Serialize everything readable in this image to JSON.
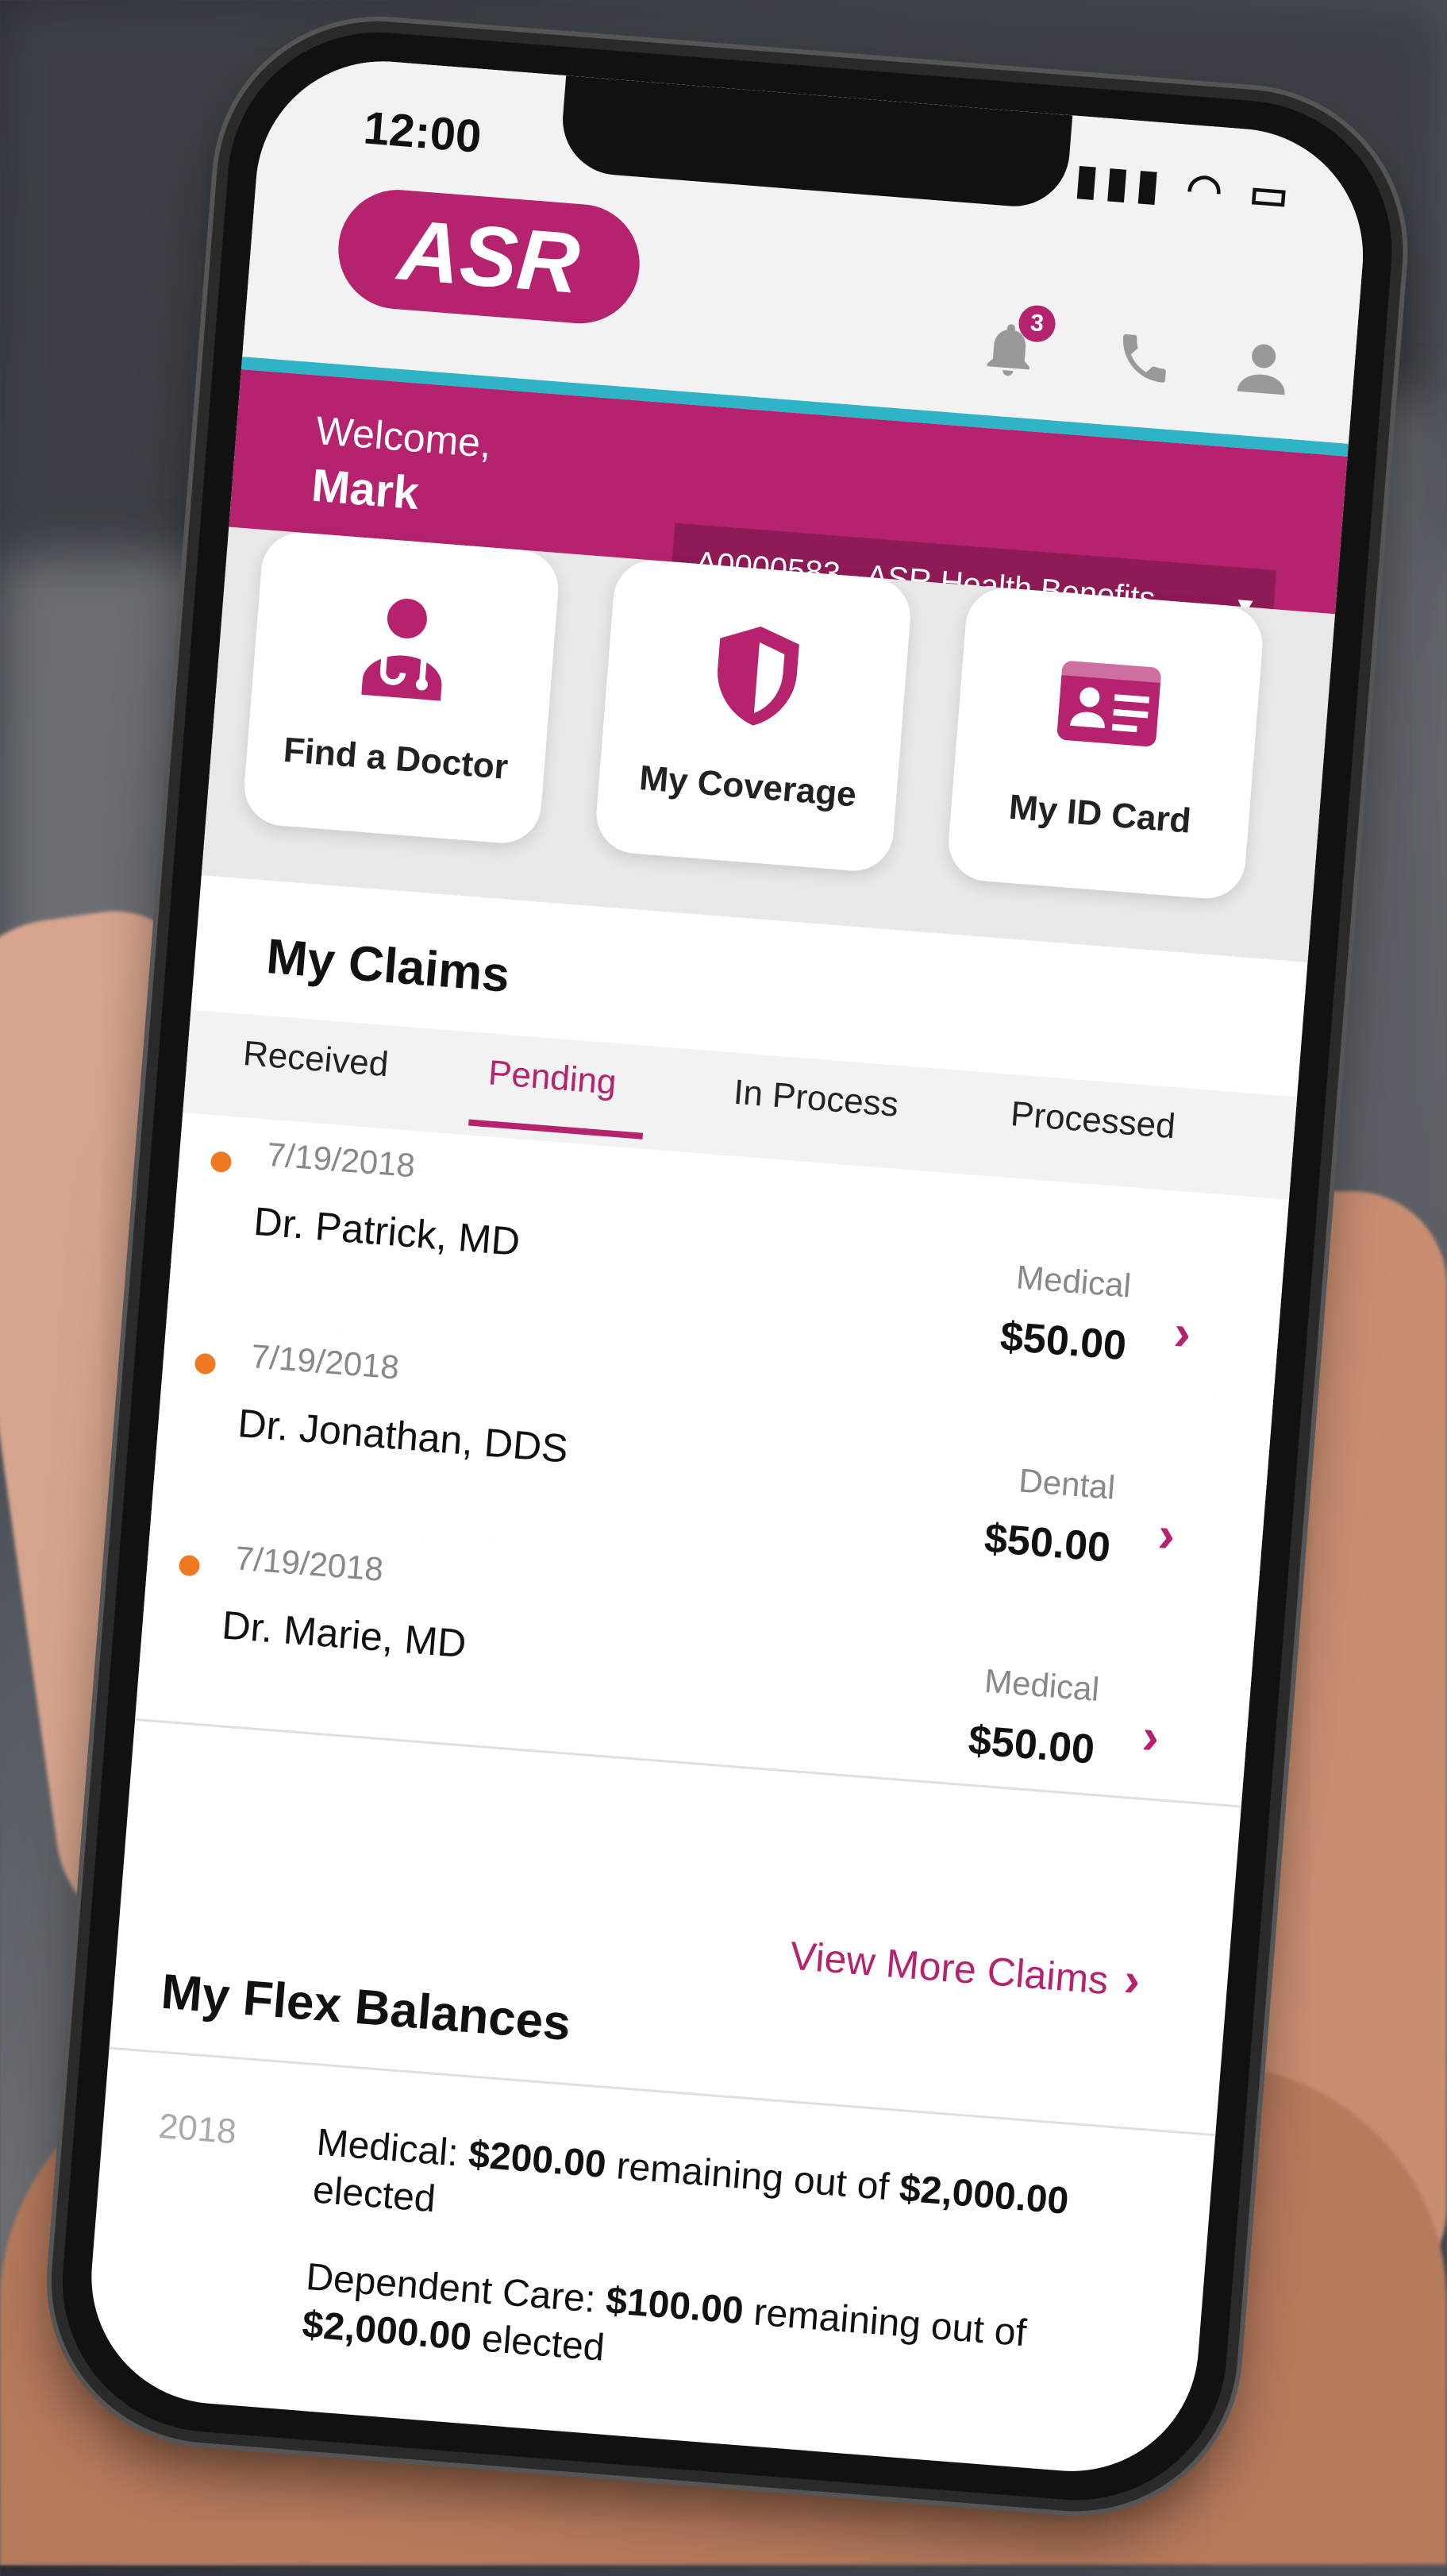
{
  "status_bar": {
    "time": "12:00",
    "icons": "signal wifi battery"
  },
  "app_bar": {
    "logo_text": "ASR",
    "notification_count": "3",
    "icons": [
      "bell-icon",
      "phone-icon",
      "user-icon"
    ]
  },
  "welcome": {
    "label": "Welcome,",
    "name": "Mark",
    "account": "A0000583 - ASR Health Benefits...",
    "dropdown_arrow": "▼"
  },
  "quick_actions": [
    {
      "label": "Find a Doctor",
      "icon": "doctor-icon"
    },
    {
      "label": "My Coverage",
      "icon": "shield-icon"
    },
    {
      "label": "My ID Card",
      "icon": "id-card-icon"
    }
  ],
  "claims": {
    "title": "My Claims",
    "tabs": [
      "Received",
      "Pending",
      "In Process",
      "Processed"
    ],
    "active_tab": "Pending",
    "items": [
      {
        "date": "7/19/2018",
        "provider": "Dr. Patrick, MD",
        "type": "Medical",
        "amount": "$50.00"
      },
      {
        "date": "7/19/2018",
        "provider": "Dr. Jonathan, DDS",
        "type": "Dental",
        "amount": "$50.00"
      },
      {
        "date": "7/19/2018",
        "provider": "Dr. Marie, MD",
        "type": "Medical",
        "amount": "$50.00"
      }
    ],
    "view_more": "View More Claims",
    "chevron": "›"
  },
  "flex": {
    "title": "My Flex Balances",
    "year": "2018",
    "lines": [
      {
        "prefix": "Medical: ",
        "remaining": "$200.00",
        "middle": " remaining out of ",
        "elected": "$2,000.00",
        "suffix": " elected"
      },
      {
        "prefix": "Dependent Care: ",
        "remaining": "$100.00",
        "middle": " remaining out of ",
        "elected": "$2,000.00",
        "suffix": " elected"
      }
    ]
  },
  "colors": {
    "brand": "#b5236f",
    "accent_teal": "#2fb3c6",
    "pending_dot": "#f07a22"
  }
}
